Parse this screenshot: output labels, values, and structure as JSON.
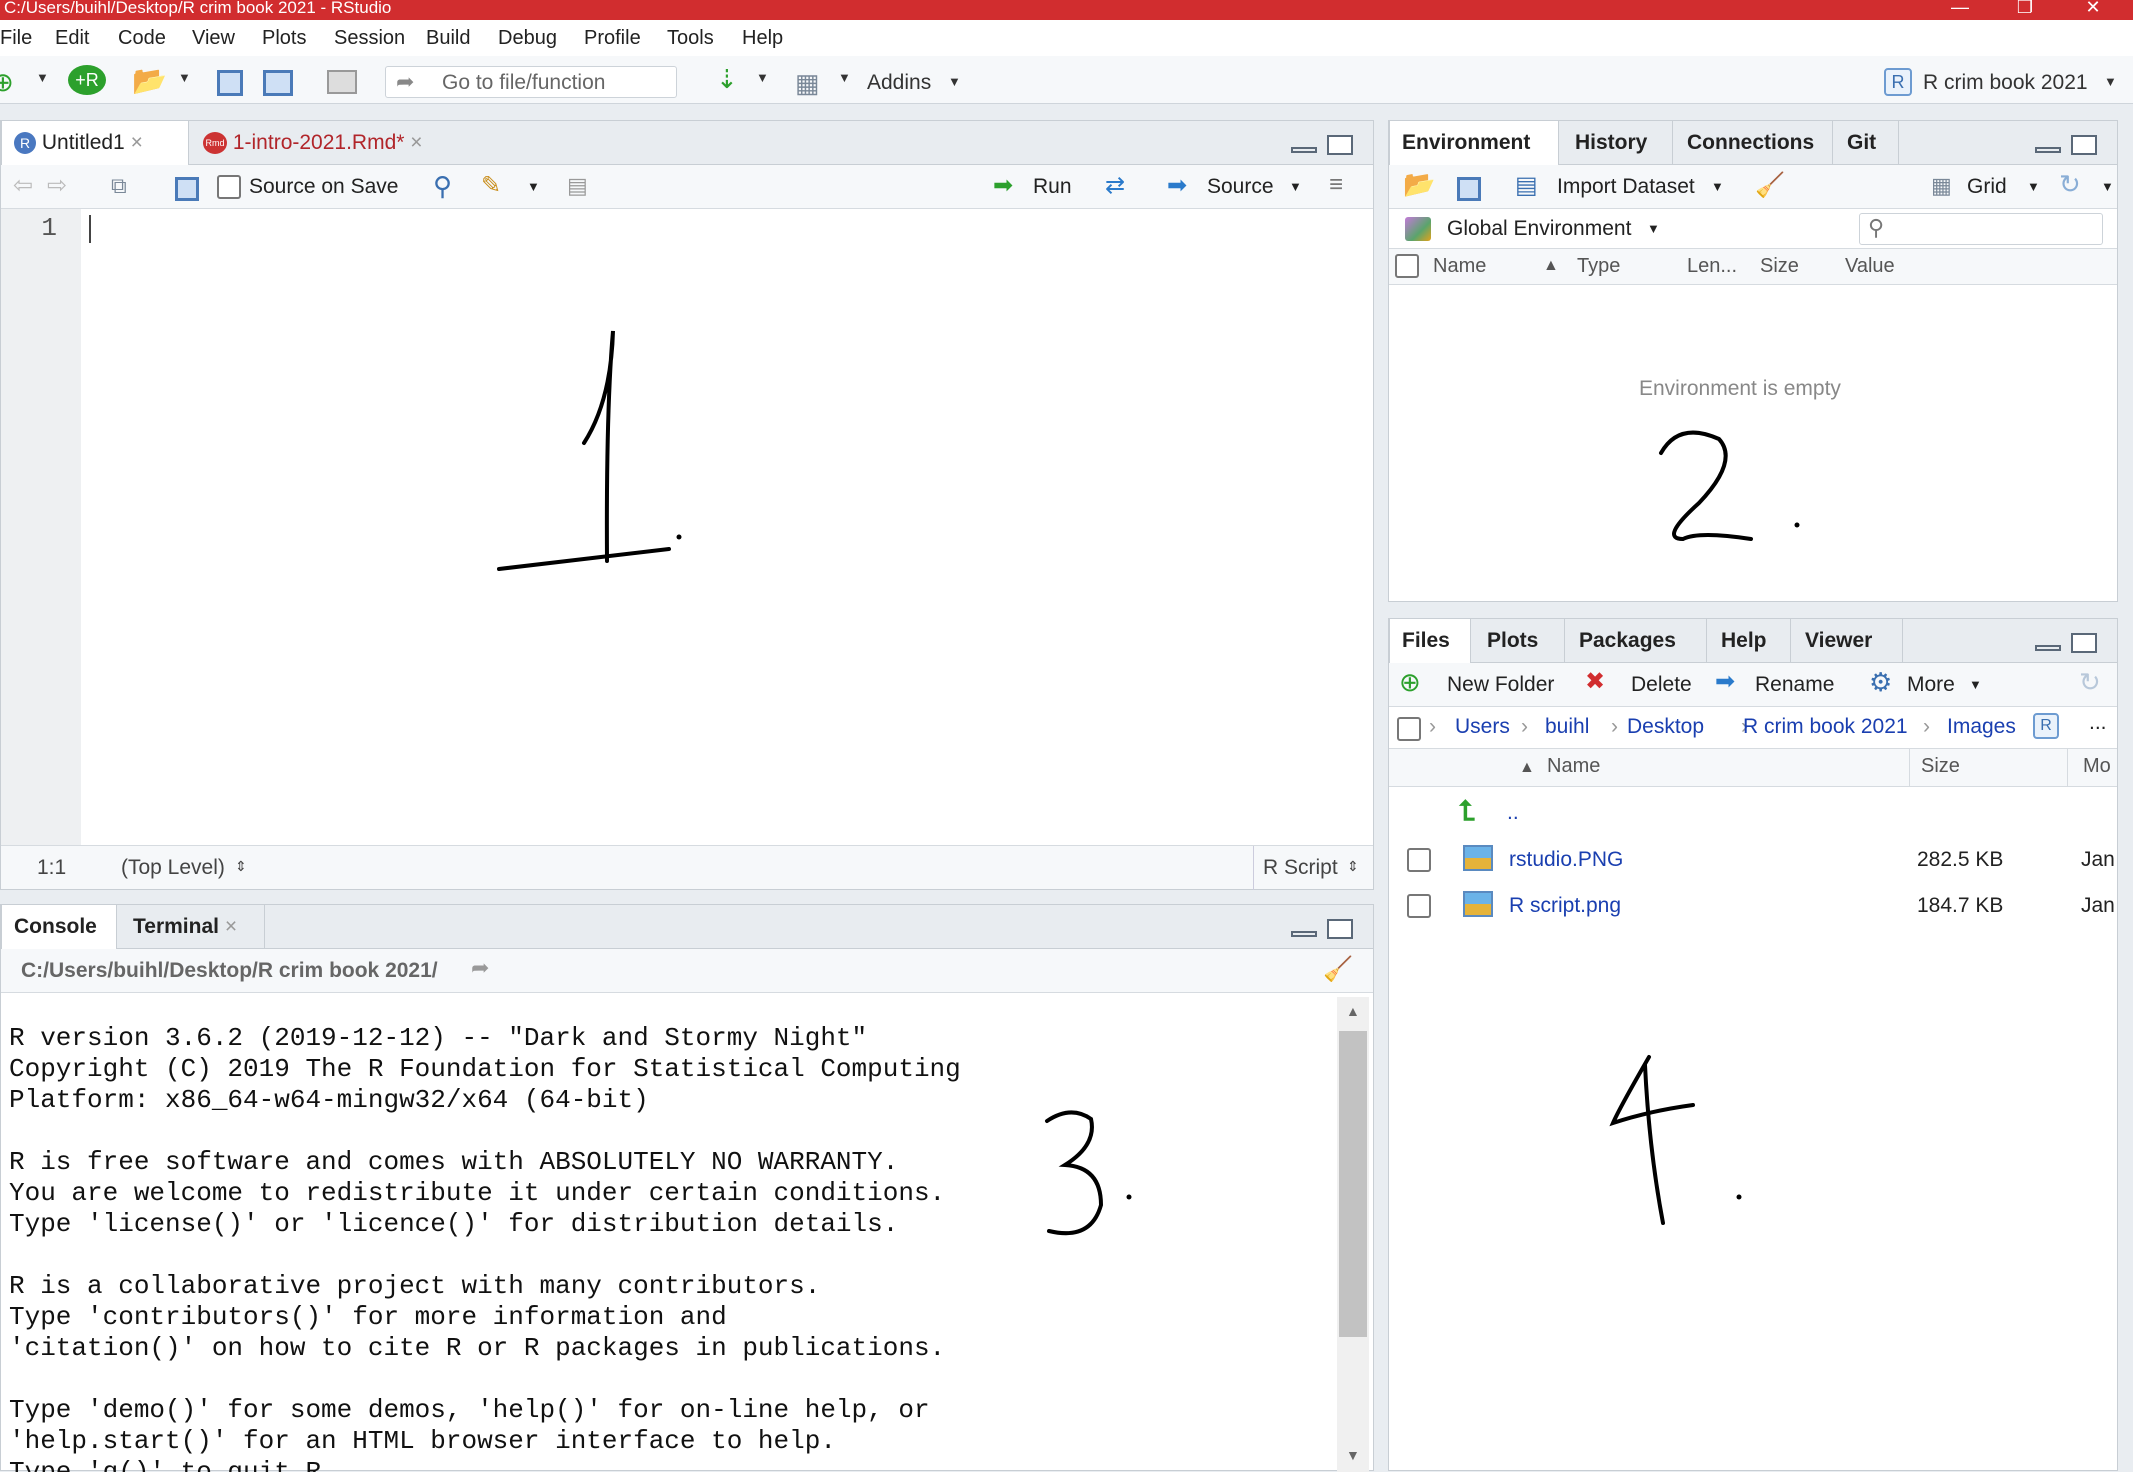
{
  "window": {
    "title": "C:/Users/buihl/Desktop/R crim book 2021 - RStudio",
    "controls": [
      "—",
      "❐",
      "✕"
    ]
  },
  "menu": [
    "File",
    "Edit",
    "Code",
    "View",
    "Plots",
    "Session",
    "Build",
    "Debug",
    "Profile",
    "Tools",
    "Help"
  ],
  "toolbar": {
    "goto_placeholder": "Go to file/function",
    "addins_label": "Addins",
    "project_label": "R crim book 2021"
  },
  "editor": {
    "tabs": [
      "Untitled1",
      "1-intro-2021.Rmd*"
    ],
    "source_on_save": "Source on Save",
    "run_label": "Run",
    "source_label": "Source",
    "line_numbers": [
      "1"
    ],
    "status_position": "1:1",
    "status_scope": "(Top Level)",
    "status_type": "R Script"
  },
  "environment": {
    "tabs": [
      "Environment",
      "History",
      "Connections",
      "Git"
    ],
    "import_dataset": "Import Dataset",
    "grid_label": "Grid",
    "scope_label": "Global Environment",
    "columns": [
      "Name",
      "Type",
      "Len...",
      "Size",
      "Value"
    ],
    "empty_message": "Environment is empty"
  },
  "console": {
    "tabs": [
      "Console",
      "Terminal"
    ],
    "path": "C:/Users/buihl/Desktop/R crim book 2021/",
    "output": "R version 3.6.2 (2019-12-12) -- \"Dark and Stormy Night\"\nCopyright (C) 2019 The R Foundation for Statistical Computing\nPlatform: x86_64-w64-mingw32/x64 (64-bit)\n\nR is free software and comes with ABSOLUTELY NO WARRANTY.\nYou are welcome to redistribute it under certain conditions.\nType 'license()' or 'licence()' for distribution details.\n\nR is a collaborative project with many contributors.\nType 'contributors()' for more information and\n'citation()' on how to cite R or R packages in publications.\n\nType 'demo()' for some demos, 'help()' for on-line help, or\n'help.start()' for an HTML browser interface to help.\nType 'q()' to quit R."
  },
  "files": {
    "tabs": [
      "Files",
      "Plots",
      "Packages",
      "Help",
      "Viewer"
    ],
    "new_folder": "New Folder",
    "delete": "Delete",
    "rename": "Rename",
    "more": "More",
    "breadcrumb": [
      "Users",
      "buihl",
      "Desktop",
      "R crim book 2021",
      "Images"
    ],
    "ellipsis": "...",
    "columns": [
      "Name",
      "Size",
      "Mo"
    ],
    "up_label": "..",
    "rows": [
      {
        "name": "rstudio.PNG",
        "size": "282.5 KB",
        "modified": "Jan"
      },
      {
        "name": "R script.png",
        "size": "184.7 KB",
        "modified": "Jan"
      }
    ]
  },
  "annotations": [
    "1.",
    "2.",
    "3.",
    "4."
  ],
  "colors": {
    "titlebar": "#d12d2f",
    "link": "#1a3fb0",
    "accent_green": "#2ca02c"
  }
}
